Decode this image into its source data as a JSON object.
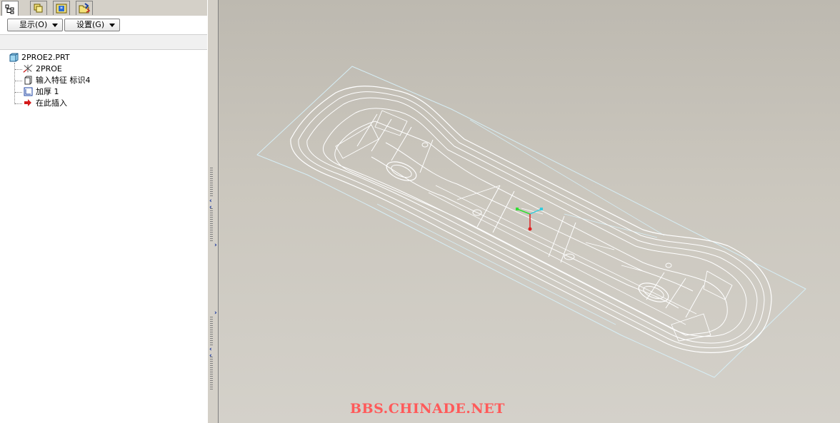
{
  "tabs": [
    {
      "icon": "model-tree-icon"
    },
    {
      "icon": "layers-icon"
    },
    {
      "icon": "favorites-icon"
    },
    {
      "icon": "folder-browser-icon"
    }
  ],
  "toolbar": {
    "show_label": "显示(O)",
    "settings_label": "设置(G)"
  },
  "tree": {
    "root": "2PROE2.PRT",
    "items": [
      {
        "label": "2PROE",
        "icon": "csys-icon"
      },
      {
        "label": "输入特征 标识4",
        "icon": "import-feature-icon"
      },
      {
        "label": "加厚 1",
        "icon": "thicken-icon"
      },
      {
        "label": "在此插入",
        "icon": "insert-here-arrow-icon"
      }
    ]
  },
  "viewport": {
    "watermark": "BBS.CHINADE.NET",
    "wire_color": "#ffffff",
    "edge_color": "#cfe8f0"
  }
}
